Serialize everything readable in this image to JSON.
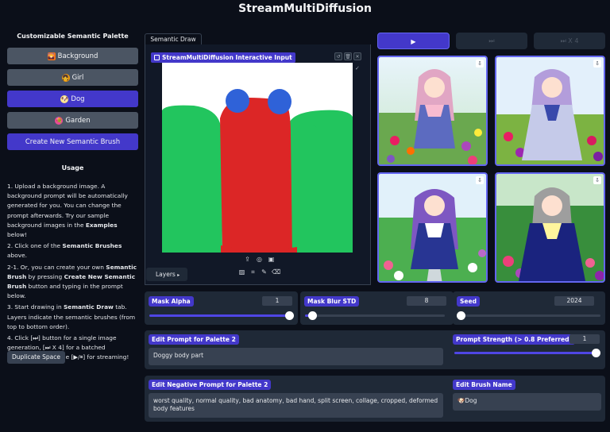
{
  "app": {
    "title": "StreamMultiDiffusion"
  },
  "palette": {
    "title": "Customizable Semantic Palette",
    "brushes": [
      {
        "emoji": "🌄",
        "label": "Background",
        "active": false
      },
      {
        "emoji": "👧",
        "label": "Girl",
        "active": false
      },
      {
        "emoji": "🐶",
        "label": "Dog",
        "active": true
      },
      {
        "emoji": "💐",
        "label": "Garden",
        "active": false
      }
    ],
    "new_brush_label": "Create New Semantic Brush"
  },
  "usage": {
    "title": "Usage",
    "step1_a": "1. Upload a background image. A background prompt will be automatically generated for you. You can change the prompt afterwards. Try our sample background images in the ",
    "step1_b": "Examples",
    "step1_c": " below!",
    "step2_a": "2. Click one of the ",
    "step2_b": "Semantic Brushes",
    "step2_c": " above.",
    "step21_a": "2-1. Or, you can create your own ",
    "step21_b": "Semantic Brush",
    "step21_c": " by pressing ",
    "step21_d": "Create New Semantic Brush",
    "step21_e": " button and typing in the prompt below.",
    "step3_a": "3. Start drawing in ",
    "step3_b": "Semantic Draw",
    "step3_c": " tab. Layers indicate the semantic brushes (from top to bottom order).",
    "step4": "4. Click [⏭] button for a single image generation, [⏭ X 4] for a batched generation, or toggle [▶/⏸] for streaming!"
  },
  "duplicate_label": "Duplicate Space",
  "draw": {
    "tab_label": "Semantic Draw",
    "interface_label": "StreamMultiDiffusion Interactive Input",
    "layers_label": "Layers",
    "canvas_colors": {
      "garden": "#22c55e",
      "girl": "#dc2626",
      "dog": "#1d4ed8"
    }
  },
  "controls": {
    "play": "▶",
    "single": "⏭",
    "batch": "⏭ X 4"
  },
  "results": [
    {
      "name": "result-1"
    },
    {
      "name": "result-2"
    },
    {
      "name": "result-3"
    },
    {
      "name": "result-4"
    }
  ],
  "sliders": {
    "mask_alpha": {
      "label": "Mask Alpha",
      "value": "1",
      "fraction": 1.0
    },
    "mask_blur": {
      "label": "Mask Blur STD",
      "value": "8",
      "fraction": 0.05
    },
    "seed": {
      "label": "Seed",
      "value": "2024",
      "fraction": 0.0
    }
  },
  "prompt": {
    "label": "Edit Prompt for Palette 2",
    "value": "Doggy body part",
    "strength_label": "Prompt Strength (> 0.8 Preferred)",
    "strength_value": "1",
    "strength_fraction": 1.0
  },
  "negative": {
    "label": "Edit Negative Prompt for Palette 2",
    "value": "worst quality, normal quality, bad anatomy, bad hand, split screen, collage, cropped, deformed body features"
  },
  "brush_name": {
    "label": "Edit Brush Name",
    "value": "🐶Dog"
  }
}
